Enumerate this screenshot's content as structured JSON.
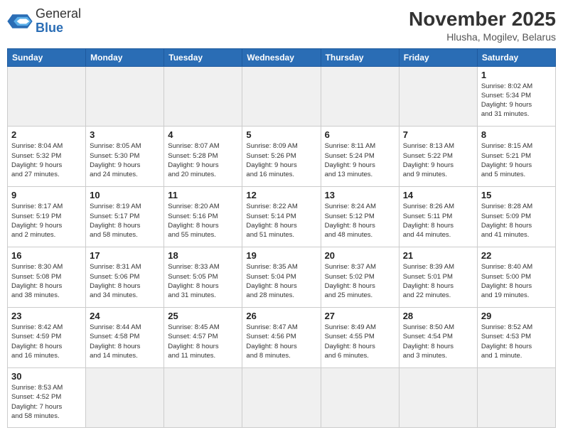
{
  "header": {
    "logo_general": "General",
    "logo_blue": "Blue",
    "month_title": "November 2025",
    "location": "Hlusha, Mogilev, Belarus"
  },
  "weekdays": [
    "Sunday",
    "Monday",
    "Tuesday",
    "Wednesday",
    "Thursday",
    "Friday",
    "Saturday"
  ],
  "weeks": [
    [
      {
        "day": "",
        "info": ""
      },
      {
        "day": "",
        "info": ""
      },
      {
        "day": "",
        "info": ""
      },
      {
        "day": "",
        "info": ""
      },
      {
        "day": "",
        "info": ""
      },
      {
        "day": "",
        "info": ""
      },
      {
        "day": "1",
        "info": "Sunrise: 8:02 AM\nSunset: 5:34 PM\nDaylight: 9 hours\nand 31 minutes."
      }
    ],
    [
      {
        "day": "2",
        "info": "Sunrise: 8:04 AM\nSunset: 5:32 PM\nDaylight: 9 hours\nand 27 minutes."
      },
      {
        "day": "3",
        "info": "Sunrise: 8:05 AM\nSunset: 5:30 PM\nDaylight: 9 hours\nand 24 minutes."
      },
      {
        "day": "4",
        "info": "Sunrise: 8:07 AM\nSunset: 5:28 PM\nDaylight: 9 hours\nand 20 minutes."
      },
      {
        "day": "5",
        "info": "Sunrise: 8:09 AM\nSunset: 5:26 PM\nDaylight: 9 hours\nand 16 minutes."
      },
      {
        "day": "6",
        "info": "Sunrise: 8:11 AM\nSunset: 5:24 PM\nDaylight: 9 hours\nand 13 minutes."
      },
      {
        "day": "7",
        "info": "Sunrise: 8:13 AM\nSunset: 5:22 PM\nDaylight: 9 hours\nand 9 minutes."
      },
      {
        "day": "8",
        "info": "Sunrise: 8:15 AM\nSunset: 5:21 PM\nDaylight: 9 hours\nand 5 minutes."
      }
    ],
    [
      {
        "day": "9",
        "info": "Sunrise: 8:17 AM\nSunset: 5:19 PM\nDaylight: 9 hours\nand 2 minutes."
      },
      {
        "day": "10",
        "info": "Sunrise: 8:19 AM\nSunset: 5:17 PM\nDaylight: 8 hours\nand 58 minutes."
      },
      {
        "day": "11",
        "info": "Sunrise: 8:20 AM\nSunset: 5:16 PM\nDaylight: 8 hours\nand 55 minutes."
      },
      {
        "day": "12",
        "info": "Sunrise: 8:22 AM\nSunset: 5:14 PM\nDaylight: 8 hours\nand 51 minutes."
      },
      {
        "day": "13",
        "info": "Sunrise: 8:24 AM\nSunset: 5:12 PM\nDaylight: 8 hours\nand 48 minutes."
      },
      {
        "day": "14",
        "info": "Sunrise: 8:26 AM\nSunset: 5:11 PM\nDaylight: 8 hours\nand 44 minutes."
      },
      {
        "day": "15",
        "info": "Sunrise: 8:28 AM\nSunset: 5:09 PM\nDaylight: 8 hours\nand 41 minutes."
      }
    ],
    [
      {
        "day": "16",
        "info": "Sunrise: 8:30 AM\nSunset: 5:08 PM\nDaylight: 8 hours\nand 38 minutes."
      },
      {
        "day": "17",
        "info": "Sunrise: 8:31 AM\nSunset: 5:06 PM\nDaylight: 8 hours\nand 34 minutes."
      },
      {
        "day": "18",
        "info": "Sunrise: 8:33 AM\nSunset: 5:05 PM\nDaylight: 8 hours\nand 31 minutes."
      },
      {
        "day": "19",
        "info": "Sunrise: 8:35 AM\nSunset: 5:04 PM\nDaylight: 8 hours\nand 28 minutes."
      },
      {
        "day": "20",
        "info": "Sunrise: 8:37 AM\nSunset: 5:02 PM\nDaylight: 8 hours\nand 25 minutes."
      },
      {
        "day": "21",
        "info": "Sunrise: 8:39 AM\nSunset: 5:01 PM\nDaylight: 8 hours\nand 22 minutes."
      },
      {
        "day": "22",
        "info": "Sunrise: 8:40 AM\nSunset: 5:00 PM\nDaylight: 8 hours\nand 19 minutes."
      }
    ],
    [
      {
        "day": "23",
        "info": "Sunrise: 8:42 AM\nSunset: 4:59 PM\nDaylight: 8 hours\nand 16 minutes."
      },
      {
        "day": "24",
        "info": "Sunrise: 8:44 AM\nSunset: 4:58 PM\nDaylight: 8 hours\nand 14 minutes."
      },
      {
        "day": "25",
        "info": "Sunrise: 8:45 AM\nSunset: 4:57 PM\nDaylight: 8 hours\nand 11 minutes."
      },
      {
        "day": "26",
        "info": "Sunrise: 8:47 AM\nSunset: 4:56 PM\nDaylight: 8 hours\nand 8 minutes."
      },
      {
        "day": "27",
        "info": "Sunrise: 8:49 AM\nSunset: 4:55 PM\nDaylight: 8 hours\nand 6 minutes."
      },
      {
        "day": "28",
        "info": "Sunrise: 8:50 AM\nSunset: 4:54 PM\nDaylight: 8 hours\nand 3 minutes."
      },
      {
        "day": "29",
        "info": "Sunrise: 8:52 AM\nSunset: 4:53 PM\nDaylight: 8 hours\nand 1 minute."
      }
    ],
    [
      {
        "day": "30",
        "info": "Sunrise: 8:53 AM\nSunset: 4:52 PM\nDaylight: 7 hours\nand 58 minutes."
      },
      {
        "day": "",
        "info": ""
      },
      {
        "day": "",
        "info": ""
      },
      {
        "day": "",
        "info": ""
      },
      {
        "day": "",
        "info": ""
      },
      {
        "day": "",
        "info": ""
      },
      {
        "day": "",
        "info": ""
      }
    ]
  ]
}
